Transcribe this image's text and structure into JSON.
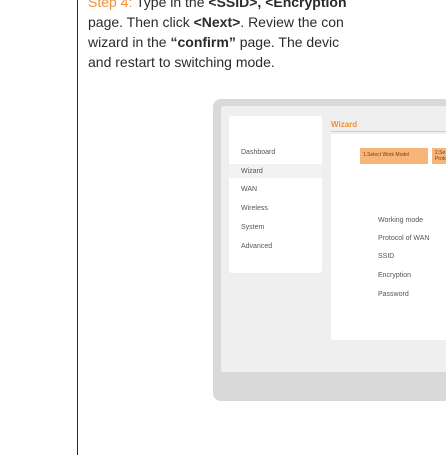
{
  "instructions": {
    "line1": {
      "step_label": "Step 4:",
      "before": " Type in the ",
      "bold": "<SSID>, <Encryption"
    },
    "line2": {
      "before": "page. Then click ",
      "bold": "<Next>",
      "after": ". Review the con"
    },
    "line3": {
      "before": "wizard in the ",
      "quoted": "“confirm”",
      "after": " page. The devic"
    },
    "line4": {
      "text": "and restart to switching mode."
    }
  },
  "screenshot": {
    "nav": [
      "Dashboard",
      "Wizard",
      "WAN",
      "Wireless",
      "System",
      "Advanced"
    ],
    "active_nav": "Wizard",
    "page_title": "Wizard",
    "steps": [
      "1.Select Work Model",
      "2.Se Proto"
    ],
    "fields": [
      "Working mode",
      "Protocol of WAN",
      "SSID",
      "Encryption",
      "Password"
    ],
    "colors": {
      "accent": "#f0923a",
      "tab": "#f7b57a",
      "frame": "#d9d9d9"
    }
  }
}
